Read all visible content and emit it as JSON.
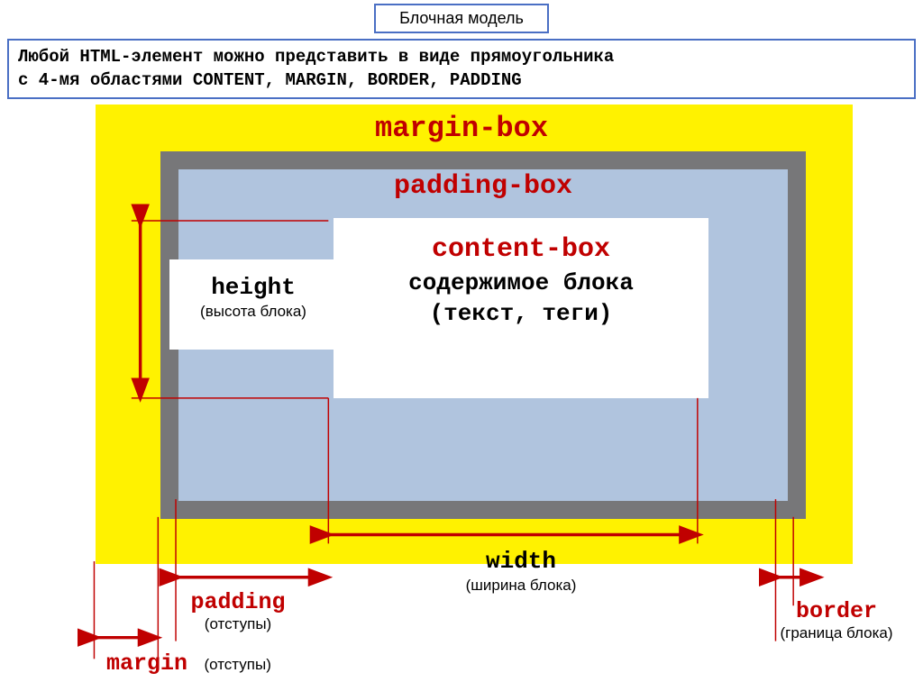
{
  "title": "Блочная модель",
  "description_line1": "Любой HTML-элемент можно представить в виде прямоугольника",
  "description_line2": "с 4-мя областями  CONTENT,  MARGIN, BORDER, PADDING",
  "boxes": {
    "margin_box": "margin-box",
    "padding_box": "padding-box",
    "content_box_title": "content-box",
    "content_box_sub1": "содержимое блока",
    "content_box_sub2": "(текст, теги)"
  },
  "dimensions": {
    "height_main": "height",
    "height_sub": "(высота блока)",
    "width_main": "width",
    "width_sub": "(ширина блока)"
  },
  "callouts": {
    "padding_main": "padding",
    "padding_sub": "(отступы)",
    "margin_main": "margin",
    "margin_sub": "(отступы)",
    "border_main": "border",
    "border_sub": "(граница блока)"
  },
  "colors": {
    "margin_bg": "#fff200",
    "border_color": "#777779",
    "padding_bg": "#b0c4de",
    "content_bg": "#ffffff",
    "accent_red": "#c00000",
    "frame_blue": "#4a6fc4"
  }
}
